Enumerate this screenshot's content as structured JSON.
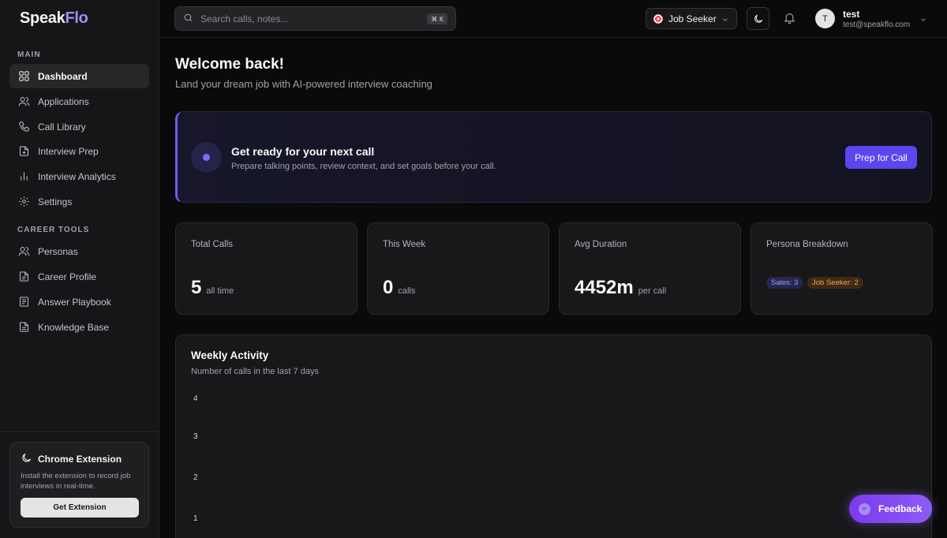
{
  "app": {
    "logo_main": "Speak",
    "logo_accent": "Flo"
  },
  "sidebar": {
    "main_label": "MAIN",
    "main_items": [
      {
        "label": "Dashboard",
        "icon": "grid-icon",
        "active": true
      },
      {
        "label": "Applications",
        "icon": "users-icon"
      },
      {
        "label": "Call Library",
        "icon": "phone-icon"
      },
      {
        "label": "Interview Prep",
        "icon": "file-plus-icon"
      },
      {
        "label": "Interview Analytics",
        "icon": "bar-chart-icon"
      },
      {
        "label": "Settings",
        "icon": "gear-icon"
      }
    ],
    "tools_label": "CAREER TOOLS",
    "tool_items": [
      {
        "label": "Personas",
        "icon": "users-icon"
      },
      {
        "label": "Career Profile",
        "icon": "file-icon"
      },
      {
        "label": "Answer Playbook",
        "icon": "book-icon"
      },
      {
        "label": "Knowledge Base",
        "icon": "document-icon"
      }
    ],
    "extension": {
      "title": "Chrome Extension",
      "description": "Install the extension to record job interviews in real-time.",
      "button": "Get Extension"
    }
  },
  "topbar": {
    "search_placeholder": "Search calls, notes...",
    "shortcut": "⌘ K",
    "persona": "Job Seeker",
    "user_initial": "T",
    "user_name": "test",
    "user_email": "test@speakflo.com"
  },
  "main": {
    "title": "Welcome back!",
    "subtitle": "Land your dream job with AI-powered interview coaching",
    "banner": {
      "title": "Get ready for your next call",
      "description": "Prepare talking points, review context, and set goals before your call.",
      "button": "Prep for Call"
    },
    "stats": [
      {
        "label": "Total Calls",
        "value": "5",
        "unit": "all time"
      },
      {
        "label": "This Week",
        "value": "0",
        "unit": "calls"
      },
      {
        "label": "Avg Duration",
        "value": "4452m",
        "unit": "per call"
      }
    ],
    "persona_breakdown": {
      "label": "Persona Breakdown",
      "badges": [
        "Sales: 3",
        "Job Seeker: 2"
      ]
    },
    "activity": {
      "title": "Weekly Activity",
      "subtitle": "Number of calls in the last 7 days",
      "y_ticks": [
        "4",
        "3",
        "2",
        "1"
      ]
    }
  },
  "feedback_label": "Feedback",
  "colors": {
    "accent": "#5b46f0",
    "background": "#0a0a0b",
    "sidebar": "#161618"
  }
}
